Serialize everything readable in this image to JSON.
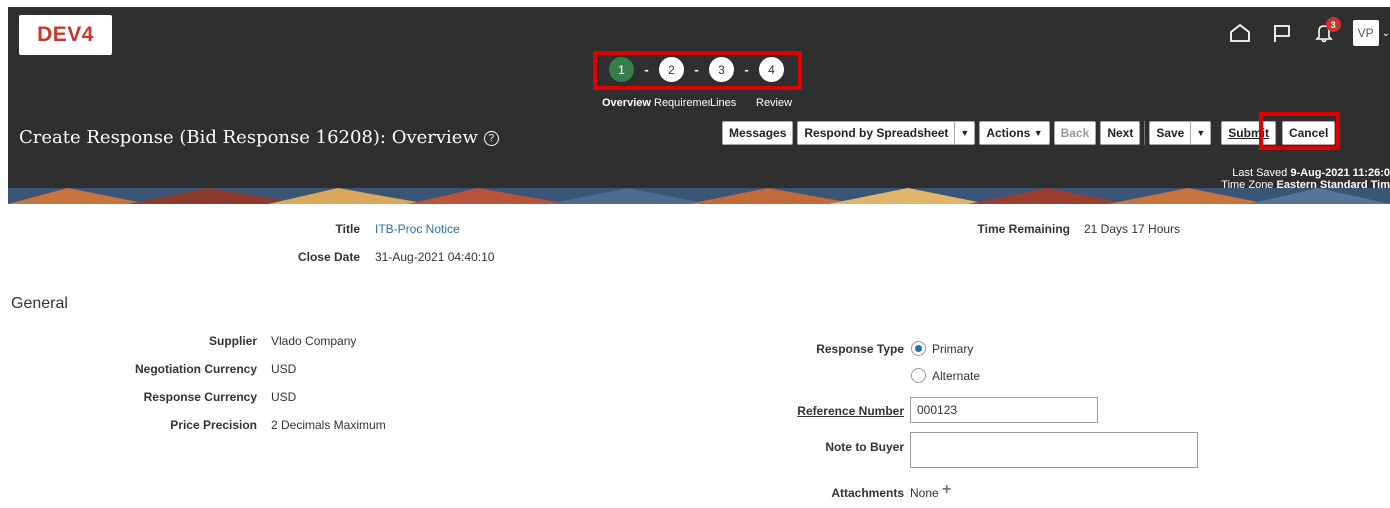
{
  "header": {
    "logo": "DEV4",
    "notification_count": "3",
    "user_initials": "VP"
  },
  "train": {
    "steps": [
      {
        "number": "1",
        "label": "Overview",
        "active": true
      },
      {
        "number": "2",
        "label": "Requirements",
        "active": false
      },
      {
        "number": "3",
        "label": "Lines",
        "active": false
      },
      {
        "number": "4",
        "label": "Review",
        "active": false
      }
    ],
    "separator": "-"
  },
  "page": {
    "title": "Create Response (Bid Response 16208): Overview",
    "help": "?"
  },
  "toolbar": {
    "messages": "Messages",
    "respond_by_spreadsheet": "Respond by Spreadsheet",
    "actions": "Actions",
    "back": "Back",
    "next": "Next",
    "save": "Save",
    "submit": "Submit",
    "cancel": "Cancel"
  },
  "status": {
    "last_saved_label": "Last Saved",
    "last_saved_value": "9-Aug-2021 11:26:0",
    "time_zone_label": "Time Zone",
    "time_zone_value": "Eastern Standard Tim"
  },
  "summary": {
    "title_label": "Title",
    "title_value": "ITB-Proc Notice",
    "close_date_label": "Close Date",
    "close_date_value": "31-Aug-2021 04:40:10",
    "time_remaining_label": "Time Remaining",
    "time_remaining_value": "21 Days 17 Hours"
  },
  "general": {
    "section_title": "General",
    "supplier_label": "Supplier",
    "supplier_value": "Vlado Company",
    "negotiation_currency_label": "Negotiation Currency",
    "negotiation_currency_value": "USD",
    "response_currency_label": "Response Currency",
    "response_currency_value": "USD",
    "price_precision_label": "Price Precision",
    "price_precision_value": "2 Decimals Maximum",
    "response_type_label": "Response Type",
    "response_type_options": [
      "Primary",
      "Alternate"
    ],
    "response_type_selected": "Primary",
    "reference_number_label": "Reference Number",
    "reference_number_value": "000123",
    "note_to_buyer_label": "Note to Buyer",
    "note_to_buyer_value": "",
    "attachments_label": "Attachments",
    "attachments_value": "None"
  }
}
